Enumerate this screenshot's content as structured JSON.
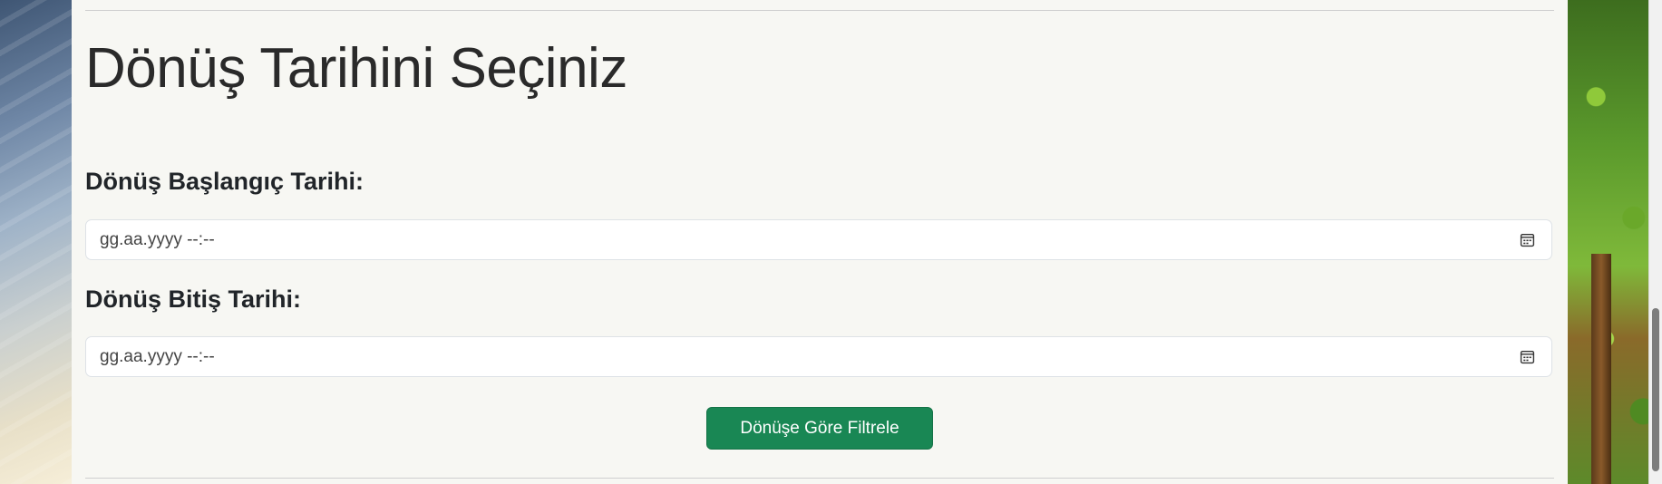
{
  "page": {
    "title": "Dönüş Tarihini Seçiniz"
  },
  "form": {
    "start": {
      "label": "Dönüş Başlangıç Tarihi:",
      "placeholder": "gg.aa.yyyy --:--"
    },
    "end": {
      "label": "Dönüş Bitiş Tarihi:",
      "placeholder": "gg.aa.yyyy --:--"
    },
    "submit_label": "Dönüşe Göre Filtrele"
  },
  "colors": {
    "panel_bg": "#f7f7f3",
    "button_bg": "#198754",
    "button_text": "#ffffff"
  },
  "icons": {
    "date_picker": "calendar-icon"
  }
}
